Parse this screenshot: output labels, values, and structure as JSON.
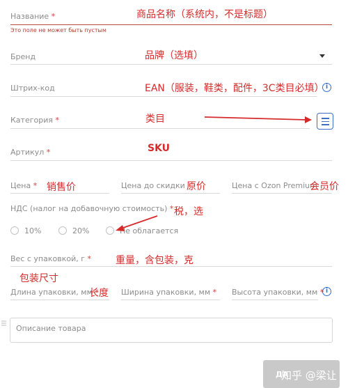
{
  "form": {
    "name": {
      "label": "Название",
      "req": "*",
      "error": "Это поле не может быть пустым"
    },
    "brand": {
      "label": "Бренд"
    },
    "barcode": {
      "label": "Штрих-код"
    },
    "category": {
      "label": "Категория",
      "req": "*"
    },
    "article": {
      "label": "Артикул",
      "req": "*"
    },
    "price": {
      "label": "Цена",
      "req": "*"
    },
    "price_before": {
      "label": "Цена до скидки"
    },
    "price_premium": {
      "label": "Цена с Ozon Premium"
    },
    "vat": {
      "label": "НДС (налог на добавочную стоимость)",
      "req": "*",
      "options": [
        "10%",
        "20%",
        "Не облагается"
      ]
    },
    "weight": {
      "label": "Вес с упаковкой, г",
      "req": "*"
    },
    "length": {
      "label": "Длина упаковки, мм",
      "req": "*"
    },
    "width": {
      "label": "Ширина упаковки, мм",
      "req": "*"
    },
    "height": {
      "label": "Высота упаковки, мм",
      "req": "*"
    },
    "description": {
      "placeholder": "Описание товара"
    },
    "info_glyph": "i",
    "button_partial": "ДА"
  },
  "annotations": {
    "name": "商品名称（系统内，不是标题）",
    "brand": "品牌（选填）",
    "ean": "EAN（服装，鞋类，配件，3C类目必填）",
    "category": "类目",
    "sku": "SKU",
    "sale_price": "销售价",
    "orig_price": "原价",
    "member_price": "会员价",
    "tax": "税，选",
    "weight": "重量，含包装，克",
    "pkg_size": "包装尺寸",
    "length": "长度"
  },
  "watermark": "知乎 @梁让",
  "colors": {
    "annotation": "#d62b2b",
    "accent_blue": "#3d6fc9",
    "error": "#b23a2e"
  },
  "icons": [
    "info-icon",
    "list-icon",
    "caret-down-icon",
    "arrow-icon",
    "drag-handle-icon"
  ]
}
